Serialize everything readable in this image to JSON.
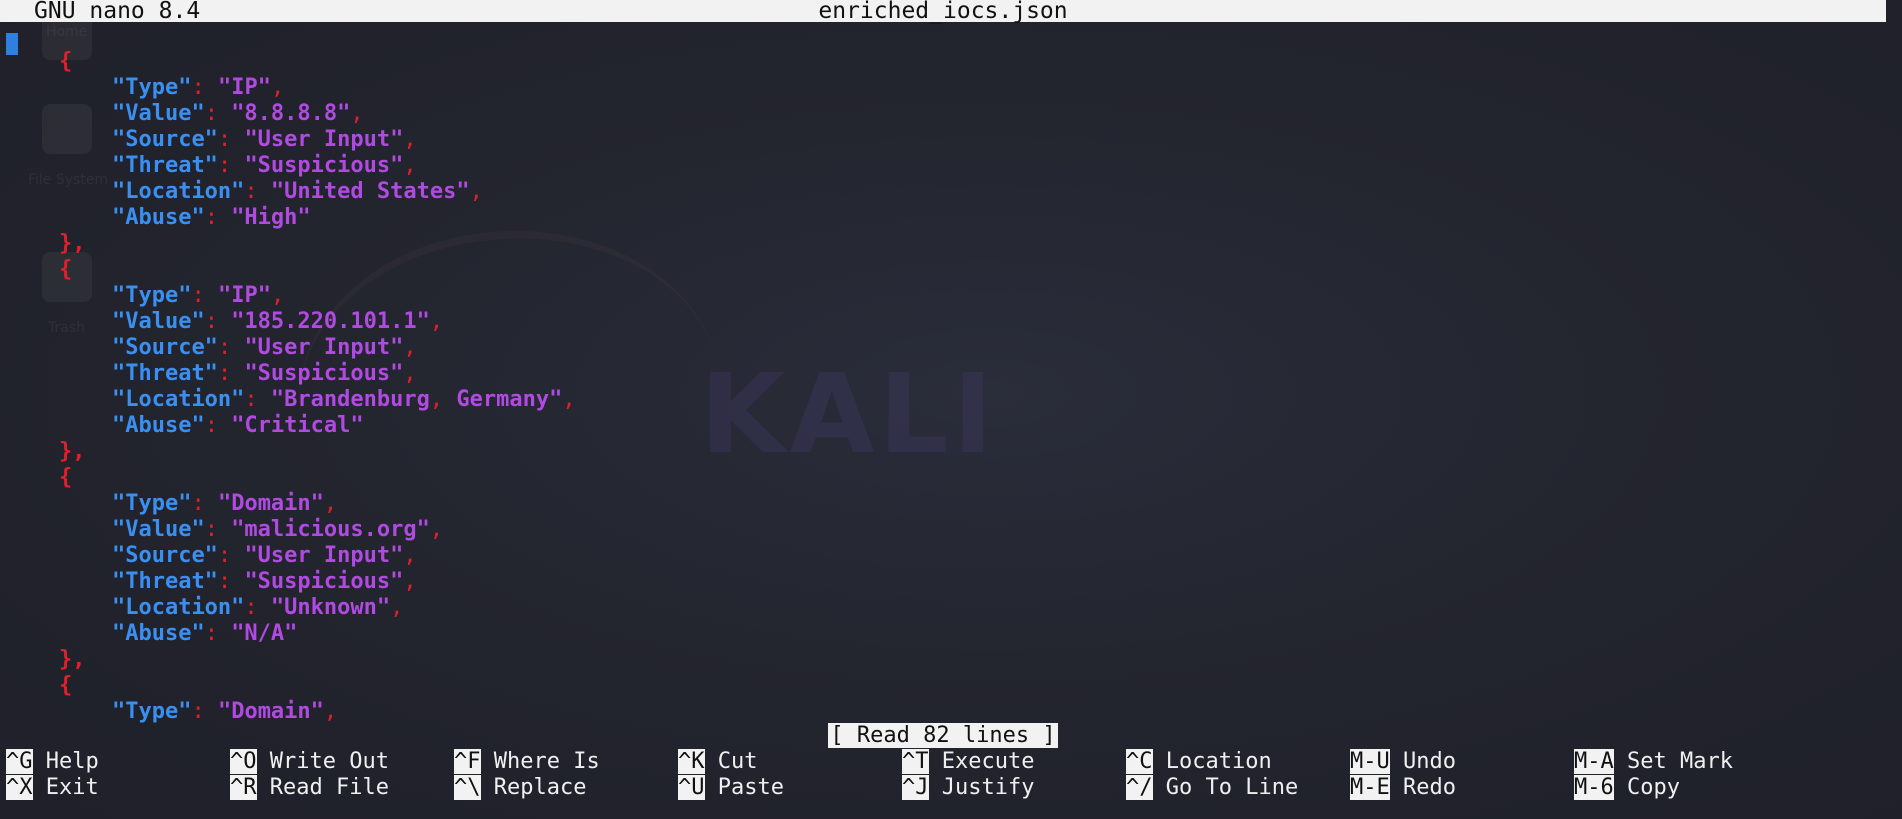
{
  "titlebar": {
    "app_name": "GNU nano 8.4",
    "filename": "enriched_iocs.json"
  },
  "desktop": {
    "icons": [
      "Home",
      "File System",
      "Trash"
    ],
    "watermark": "KALI"
  },
  "editor": {
    "lines": [
      {
        "indent": "",
        "parts": [
          {
            "t": "[",
            "c": "cursor"
          }
        ]
      },
      {
        "indent": "    ",
        "parts": [
          {
            "t": "{",
            "c": "brace"
          }
        ]
      },
      {
        "indent": "        ",
        "parts": [
          {
            "t": "\"Type\"",
            "c": "key"
          },
          {
            "t": ": ",
            "c": "punct"
          },
          {
            "t": "\"IP\"",
            "c": "val"
          },
          {
            "t": ",",
            "c": "punct"
          }
        ]
      },
      {
        "indent": "        ",
        "parts": [
          {
            "t": "\"Value\"",
            "c": "key"
          },
          {
            "t": ": ",
            "c": "punct"
          },
          {
            "t": "\"8.8.8.8\"",
            "c": "val"
          },
          {
            "t": ",",
            "c": "punct"
          }
        ]
      },
      {
        "indent": "        ",
        "parts": [
          {
            "t": "\"Source\"",
            "c": "key"
          },
          {
            "t": ": ",
            "c": "punct"
          },
          {
            "t": "\"User Input\"",
            "c": "val"
          },
          {
            "t": ",",
            "c": "punct"
          }
        ]
      },
      {
        "indent": "        ",
        "parts": [
          {
            "t": "\"Threat\"",
            "c": "key"
          },
          {
            "t": ": ",
            "c": "punct"
          },
          {
            "t": "\"Suspicious\"",
            "c": "val"
          },
          {
            "t": ",",
            "c": "punct"
          }
        ]
      },
      {
        "indent": "        ",
        "parts": [
          {
            "t": "\"Location\"",
            "c": "key"
          },
          {
            "t": ": ",
            "c": "punct"
          },
          {
            "t": "\"United States\"",
            "c": "val"
          },
          {
            "t": ",",
            "c": "punct"
          }
        ]
      },
      {
        "indent": "        ",
        "parts": [
          {
            "t": "\"Abuse\"",
            "c": "key"
          },
          {
            "t": ": ",
            "c": "punct"
          },
          {
            "t": "\"High\"",
            "c": "val"
          }
        ]
      },
      {
        "indent": "    ",
        "parts": [
          {
            "t": "},",
            "c": "brace"
          }
        ]
      },
      {
        "indent": "    ",
        "parts": [
          {
            "t": "{",
            "c": "brace"
          }
        ]
      },
      {
        "indent": "        ",
        "parts": [
          {
            "t": "\"Type\"",
            "c": "key"
          },
          {
            "t": ": ",
            "c": "punct"
          },
          {
            "t": "\"IP\"",
            "c": "val"
          },
          {
            "t": ",",
            "c": "punct"
          }
        ]
      },
      {
        "indent": "        ",
        "parts": [
          {
            "t": "\"Value\"",
            "c": "key"
          },
          {
            "t": ": ",
            "c": "punct"
          },
          {
            "t": "\"185.220.101.1\"",
            "c": "val"
          },
          {
            "t": ",",
            "c": "punct"
          }
        ]
      },
      {
        "indent": "        ",
        "parts": [
          {
            "t": "\"Source\"",
            "c": "key"
          },
          {
            "t": ": ",
            "c": "punct"
          },
          {
            "t": "\"User Input\"",
            "c": "val"
          },
          {
            "t": ",",
            "c": "punct"
          }
        ]
      },
      {
        "indent": "        ",
        "parts": [
          {
            "t": "\"Threat\"",
            "c": "key"
          },
          {
            "t": ": ",
            "c": "punct"
          },
          {
            "t": "\"Suspicious\"",
            "c": "val"
          },
          {
            "t": ",",
            "c": "punct"
          }
        ]
      },
      {
        "indent": "        ",
        "parts": [
          {
            "t": "\"Location\"",
            "c": "key"
          },
          {
            "t": ": ",
            "c": "punct"
          },
          {
            "t": "\"Brandenburg",
            "c": "val"
          },
          {
            "t": ", ",
            "c": "punct"
          },
          {
            "t": "Germany\"",
            "c": "val"
          },
          {
            "t": ",",
            "c": "punct"
          }
        ]
      },
      {
        "indent": "        ",
        "parts": [
          {
            "t": "\"Abuse\"",
            "c": "key"
          },
          {
            "t": ": ",
            "c": "punct"
          },
          {
            "t": "\"Critical\"",
            "c": "val"
          }
        ]
      },
      {
        "indent": "    ",
        "parts": [
          {
            "t": "},",
            "c": "brace"
          }
        ]
      },
      {
        "indent": "    ",
        "parts": [
          {
            "t": "{",
            "c": "brace"
          }
        ]
      },
      {
        "indent": "        ",
        "parts": [
          {
            "t": "\"Type\"",
            "c": "key"
          },
          {
            "t": ": ",
            "c": "punct"
          },
          {
            "t": "\"Domain\"",
            "c": "val"
          },
          {
            "t": ",",
            "c": "punct"
          }
        ]
      },
      {
        "indent": "        ",
        "parts": [
          {
            "t": "\"Value\"",
            "c": "key"
          },
          {
            "t": ": ",
            "c": "punct"
          },
          {
            "t": "\"malicious.org\"",
            "c": "val"
          },
          {
            "t": ",",
            "c": "punct"
          }
        ]
      },
      {
        "indent": "        ",
        "parts": [
          {
            "t": "\"Source\"",
            "c": "key"
          },
          {
            "t": ": ",
            "c": "punct"
          },
          {
            "t": "\"User Input\"",
            "c": "val"
          },
          {
            "t": ",",
            "c": "punct"
          }
        ]
      },
      {
        "indent": "        ",
        "parts": [
          {
            "t": "\"Threat\"",
            "c": "key"
          },
          {
            "t": ": ",
            "c": "punct"
          },
          {
            "t": "\"Suspicious\"",
            "c": "val"
          },
          {
            "t": ",",
            "c": "punct"
          }
        ]
      },
      {
        "indent": "        ",
        "parts": [
          {
            "t": "\"Location\"",
            "c": "key"
          },
          {
            "t": ": ",
            "c": "punct"
          },
          {
            "t": "\"Unknown\"",
            "c": "val"
          },
          {
            "t": ",",
            "c": "punct"
          }
        ]
      },
      {
        "indent": "        ",
        "parts": [
          {
            "t": "\"Abuse\"",
            "c": "key"
          },
          {
            "t": ": ",
            "c": "punct"
          },
          {
            "t": "\"N/A\"",
            "c": "val"
          }
        ]
      },
      {
        "indent": "    ",
        "parts": [
          {
            "t": "},",
            "c": "brace"
          }
        ]
      },
      {
        "indent": "    ",
        "parts": [
          {
            "t": "{",
            "c": "brace"
          }
        ]
      },
      {
        "indent": "        ",
        "parts": [
          {
            "t": "\"Type\"",
            "c": "key"
          },
          {
            "t": ": ",
            "c": "punct"
          },
          {
            "t": "\"Domain\"",
            "c": "val"
          },
          {
            "t": ",",
            "c": "punct"
          }
        ]
      }
    ]
  },
  "status_message": "[ Read 82 lines ]",
  "shortcuts": [
    [
      {
        "key": "^G",
        "label": "Help"
      },
      {
        "key": "^O",
        "label": "Write Out"
      },
      {
        "key": "^F",
        "label": "Where Is"
      },
      {
        "key": "^K",
        "label": "Cut"
      },
      {
        "key": "^T",
        "label": "Execute"
      },
      {
        "key": "^C",
        "label": "Location"
      },
      {
        "key": "M-U",
        "label": "Undo"
      },
      {
        "key": "M-A",
        "label": "Set Mark"
      }
    ],
    [
      {
        "key": "^X",
        "label": "Exit"
      },
      {
        "key": "^R",
        "label": "Read File"
      },
      {
        "key": "^\\",
        "label": "Replace"
      },
      {
        "key": "^U",
        "label": "Paste"
      },
      {
        "key": "^J",
        "label": "Justify"
      },
      {
        "key": "^/",
        "label": "Go To Line"
      },
      {
        "key": "M-E",
        "label": "Redo"
      },
      {
        "key": "M-6",
        "label": "Copy"
      }
    ]
  ],
  "colors": {
    "key": "#3a8ff0",
    "value": "#b04ae0",
    "brace": "#e0202a",
    "bar_bg": "#f2f2f2",
    "terminal_bg": "#22242e"
  }
}
